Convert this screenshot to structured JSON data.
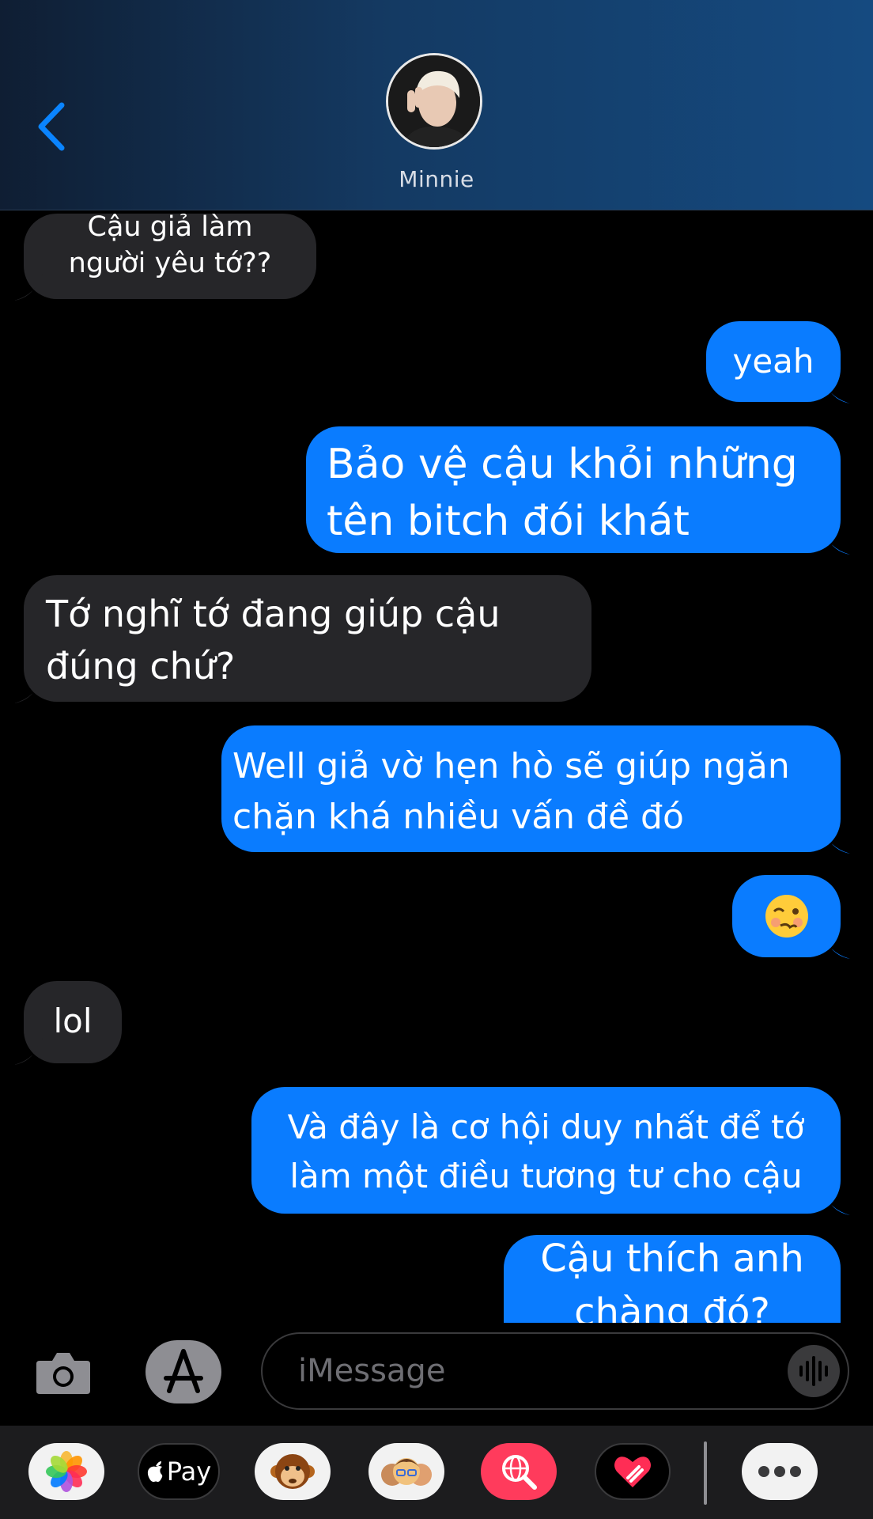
{
  "header": {
    "contact_name": "Minnie"
  },
  "messages": [
    {
      "side": "in",
      "lines": [
        "Cậu giả làm",
        "người yêu tớ??"
      ]
    },
    {
      "side": "out",
      "lines": [
        "yeah"
      ]
    },
    {
      "side": "out",
      "lines": [
        "Bảo vệ cậu khỏi những",
        "tên bitch đói khát"
      ]
    },
    {
      "side": "in",
      "lines": [
        "Tớ nghĩ tớ đang giúp cậu",
        "đúng chứ?"
      ]
    },
    {
      "side": "out",
      "lines": [
        "Well giả vờ hẹn hò sẽ giúp ngăn",
        "chặn khá nhiều vấn đề đó"
      ]
    },
    {
      "side": "out",
      "lines": [
        "🥴"
      ]
    },
    {
      "side": "in",
      "lines": [
        "lol"
      ]
    },
    {
      "side": "out",
      "lines": [
        "Và đây là cơ hội duy nhất để tớ",
        "làm một điều tương tư cho cậu"
      ]
    },
    {
      "side": "out",
      "lines": [
        "Cậu thích anh",
        "chàng đó?"
      ]
    }
  ],
  "composer": {
    "placeholder": "iMessage"
  },
  "drawer": {
    "apps": [
      {
        "name": "photos",
        "label": ""
      },
      {
        "name": "apple-pay",
        "label": "Pay"
      },
      {
        "name": "animoji",
        "label": ""
      },
      {
        "name": "memoji",
        "label": ""
      },
      {
        "name": "search-images",
        "label": ""
      },
      {
        "name": "digital-touch",
        "label": ""
      },
      {
        "name": "more",
        "label": ""
      }
    ]
  },
  "colors": {
    "outgoing_bubble": "#0a7cff",
    "incoming_bubble": "#262629",
    "accent": "#0a84ff"
  },
  "icons": [
    "chevron-left-icon",
    "camera-icon",
    "app-store-icon",
    "waveform-icon",
    "apple-logo-icon",
    "more-icon"
  ]
}
